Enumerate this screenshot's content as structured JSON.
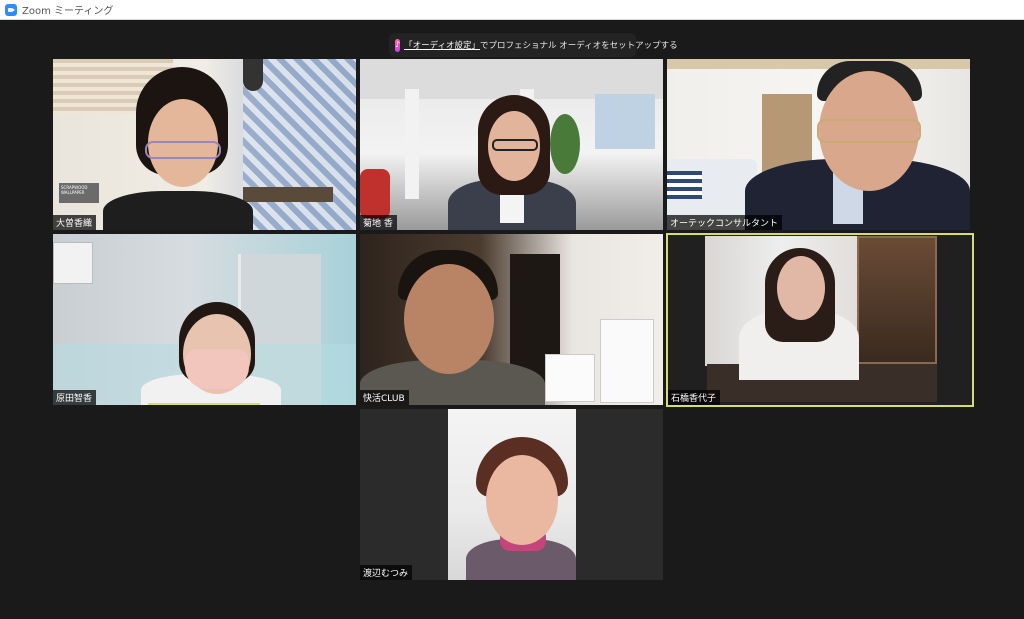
{
  "window": {
    "title": "Zoom ミーティング"
  },
  "banner": {
    "link_text": "「オーディオ設定」",
    "text": "でプロフェショナル オーディオをセットアップする",
    "icon": "music-note-icon"
  },
  "participants": [
    {
      "name": "大曽香織"
    },
    {
      "name": "菊地 香"
    },
    {
      "name": "オーテックコンサルタント"
    },
    {
      "name": "原田智香"
    },
    {
      "name": "快活CLUB"
    },
    {
      "name": "石橋香代子",
      "active_speaker": true
    },
    {
      "name": "渡辺むつみ"
    }
  ],
  "background_texts": {
    "wallpaper_sign": "SCRAPWOOD\nWALLPAPER"
  },
  "colors": {
    "background": "#1a1a1a",
    "active_speaker_border": "#d8dd6a",
    "zoom_blue": "#2d8cff"
  }
}
